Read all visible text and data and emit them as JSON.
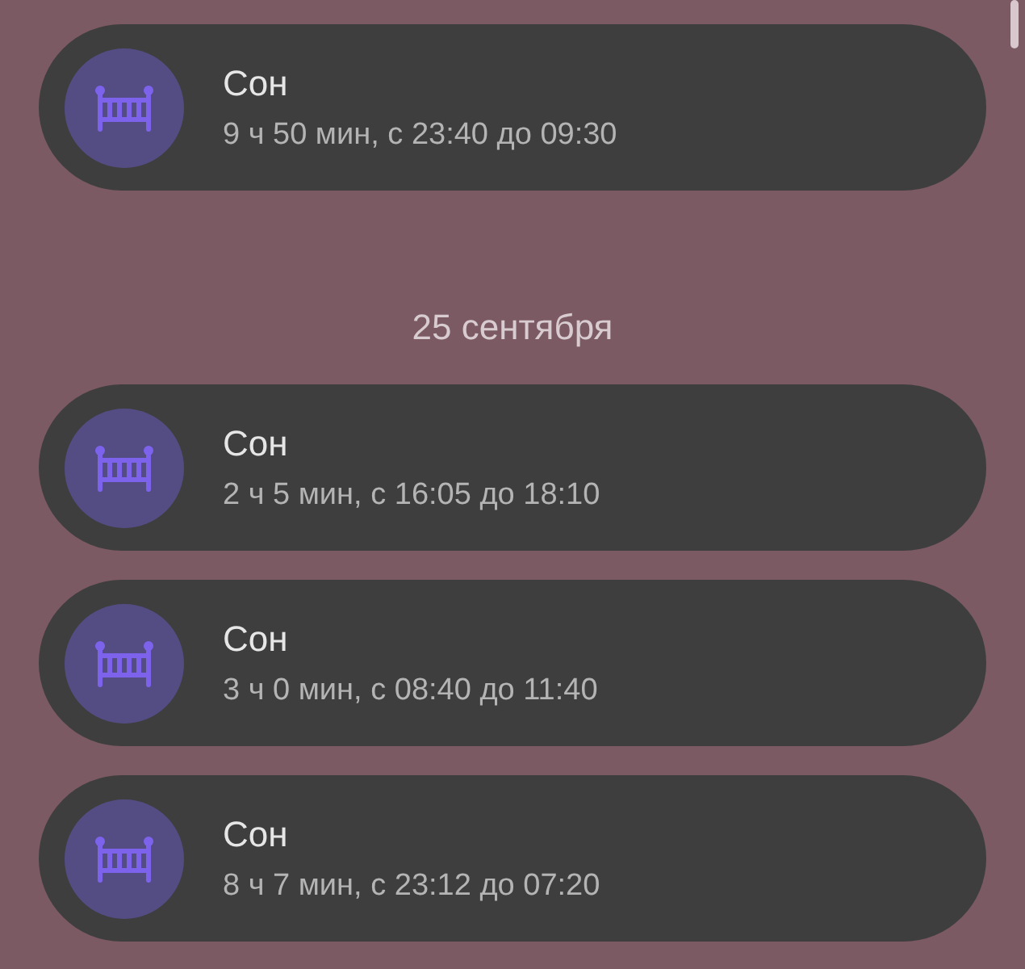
{
  "groups": [
    {
      "entries": [
        {
          "title": "Сон",
          "detail": "9 ч 50 мин, с 23:40 до 09:30"
        }
      ]
    },
    {
      "date": "25 сентября",
      "entries": [
        {
          "title": "Сон",
          "detail": "2 ч 5 мин, с 16:05 до 18:10"
        },
        {
          "title": "Сон",
          "detail": "3 ч 0 мин, с 08:40 до 11:40"
        },
        {
          "title": "Сон",
          "detail": "8 ч 7 мин, с 23:12 до 07:20"
        }
      ]
    }
  ]
}
